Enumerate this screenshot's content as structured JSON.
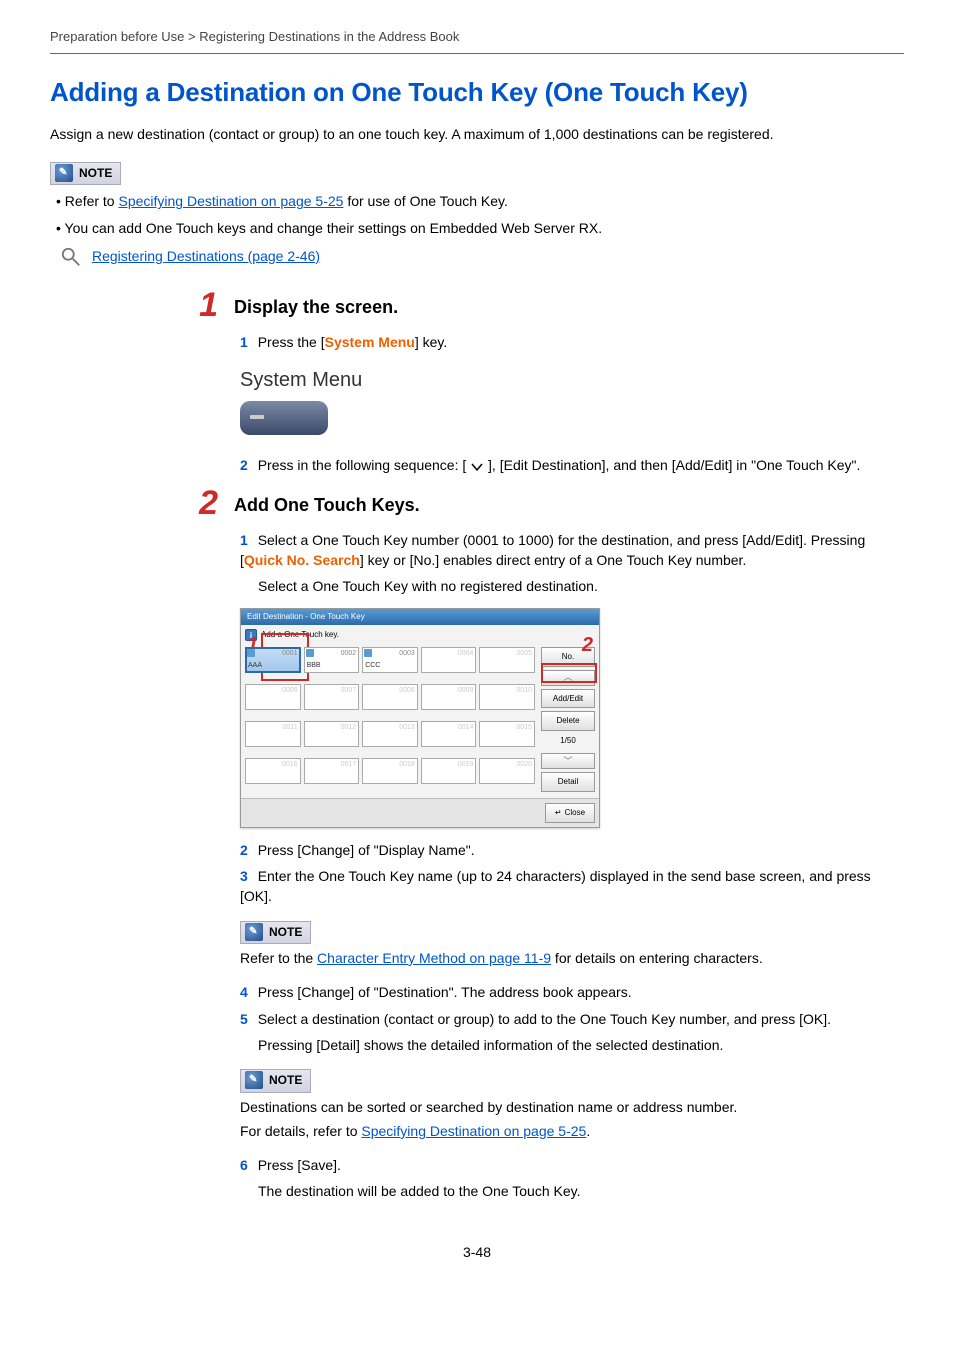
{
  "breadcrumb": "Preparation before Use > Registering Destinations in the Address Book",
  "title": "Adding a Destination on One Touch Key (One Touch Key)",
  "intro": "Assign a new destination (contact or group) to an one touch key. A maximum of 1,000 destinations can be registered.",
  "noteLabel": "NOTE",
  "notes": {
    "line1a": "Refer to ",
    "line1link": "Specifying Destination on page 5-25",
    "line1b": " for use of One Touch Key.",
    "line2": "You can add One Touch keys and change their settings on Embedded Web Server RX."
  },
  "magLink": "Registering Destinations (page 2-46)",
  "step1": {
    "num": "1",
    "heading": "Display the screen.",
    "sub1num": "1",
    "sub1a": "Press the [",
    "sub1key": "System Menu",
    "sub1b": "] key.",
    "sysMenuLabel": "System Menu",
    "sub2num": "2",
    "sub2a": "Press in the following sequence: [ ",
    "sub2b": " ], [Edit Destination], and then [Add/Edit] in \"One Touch Key\"."
  },
  "step2": {
    "num": "2",
    "heading": "Add One Touch Keys.",
    "sub1": {
      "num": "1",
      "textA": "Select a One Touch Key number (0001 to 1000) for the destination, and press [Add/Edit]. Pressing [",
      "key": "Quick No. Search",
      "textB": "] key or [No.] enables direct entry of a One Touch Key number.",
      "hint": "Select a One Touch Key with no registered destination."
    },
    "panel": {
      "title": "Edit Destination - One Touch Key",
      "info": "Add a One Touch key.",
      "callout1": "1",
      "callout2": "2",
      "cells": [
        {
          "num": "0001",
          "label": "AAA",
          "sel": true,
          "icon": true
        },
        {
          "num": "0002",
          "label": "BBB",
          "icon": true
        },
        {
          "num": "0003",
          "label": "CCC",
          "icon": true
        },
        {
          "num": "0004",
          "dis": true
        },
        {
          "num": "0005",
          "dis": true
        },
        {
          "num": "0006",
          "dis": true
        },
        {
          "num": "0007",
          "dis": true
        },
        {
          "num": "0008",
          "dis": true
        },
        {
          "num": "0009",
          "dis": true
        },
        {
          "num": "0010",
          "dis": true
        },
        {
          "num": "0011",
          "dis": true
        },
        {
          "num": "0012",
          "dis": true
        },
        {
          "num": "0013",
          "dis": true
        },
        {
          "num": "0014",
          "dis": true
        },
        {
          "num": "0015",
          "dis": true
        },
        {
          "num": "0016",
          "dis": true
        },
        {
          "num": "0017",
          "dis": true
        },
        {
          "num": "0018",
          "dis": true
        },
        {
          "num": "0019",
          "dis": true
        },
        {
          "num": "0020",
          "dis": true
        }
      ],
      "noBtn": "No.",
      "addBtn": "Add/Edit",
      "delBtn": "Delete",
      "detailBtn": "Detail",
      "page": "1/50",
      "close": "Close"
    },
    "sub2": {
      "num": "2",
      "text": "Press [Change] of \"Display Name\"."
    },
    "sub3": {
      "num": "3",
      "text": "Enter the One Touch Key name (up to 24 characters) displayed in the send base screen, and press [OK]."
    },
    "note3a": "Refer to the ",
    "note3link": "Character Entry Method on page 11-9",
    "note3b": " for details on entering characters.",
    "sub4": {
      "num": "4",
      "text": "Press [Change] of \"Destination\". The address book appears."
    },
    "sub5": {
      "num": "5",
      "text": "Select a destination (contact or group) to add to the One Touch Key number, and press [OK].",
      "hint": "Pressing [Detail] shows the detailed information of the selected destination."
    },
    "note5a": "Destinations can be sorted or searched by destination name or address number.",
    "note5b": "For details, refer to ",
    "note5link": "Specifying Destination on page 5-25",
    "note5c": ".",
    "sub6": {
      "num": "6",
      "text": "Press [Save].",
      "hint": "The destination will be added to the One Touch Key."
    }
  },
  "pageNumber": "3-48"
}
